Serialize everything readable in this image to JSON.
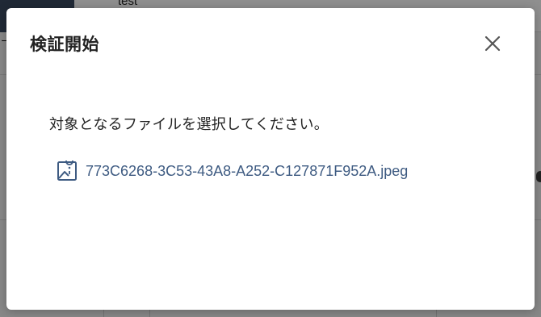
{
  "background": {
    "header_text": "test",
    "edge_glyph": "ー"
  },
  "dialog": {
    "title": "検証開始",
    "close_icon": "close-icon",
    "instruction": "対象となるファイルを選択してください。",
    "file": {
      "icon": "image-file-icon",
      "name": "773C6268-3C53-43A8-A252-C127871F952A.jpeg"
    }
  },
  "colors": {
    "link": "#3e5b82",
    "overlay": "rgba(0,0,0,0.44)"
  }
}
